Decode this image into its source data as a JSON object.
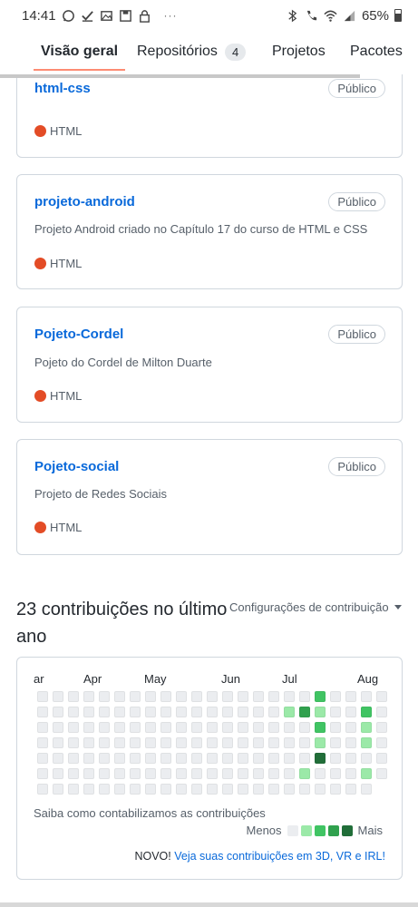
{
  "status_bar": {
    "time": "14:41",
    "battery": "65%",
    "left_icons": [
      "whatsapp-icon",
      "check-icon",
      "image-icon",
      "save-icon",
      "lock-icon"
    ],
    "right_icons": [
      "bluetooth-icon",
      "wifi-call-icon",
      "wifi-icon",
      "signal-icon",
      "battery-icon"
    ]
  },
  "tabs": [
    {
      "label": "Visão geral",
      "active": true
    },
    {
      "label": "Repositórios",
      "count": "4"
    },
    {
      "label": "Projetos"
    },
    {
      "label": "Pacotes"
    }
  ],
  "repos": [
    {
      "name": "html-css",
      "visibility": "Público",
      "description": "",
      "language": "HTML"
    },
    {
      "name": "projeto-android",
      "visibility": "Público",
      "description": "Projeto Android criado no Capítulo 17 do curso de HTML e CSS",
      "language": "HTML"
    },
    {
      "name": "Pojeto-Cordel",
      "visibility": "Público",
      "description": "Pojeto do Cordel de Milton Duarte",
      "language": "HTML"
    },
    {
      "name": "Pojeto-social",
      "visibility": "Público",
      "description": "Projeto de Redes Sociais",
      "language": "HTML"
    }
  ],
  "contributions": {
    "title": "23 contribuições no último ano",
    "settings_label": "Configurações de contribuição",
    "months": [
      "ar",
      "Apr",
      "May",
      "Jun",
      "Jul",
      "Aug"
    ],
    "learn_text": "Saiba como contabilizamos as contribuições",
    "legend_less": "Menos",
    "legend_more": "Mais",
    "new_prefix": "NOVO!",
    "new_link": "Veja suas contribuições em 3D, VR e IRL!",
    "levels_colors": [
      "#ebedf0",
      "#9be9a8",
      "#40c463",
      "#30a14e",
      "#216e39"
    ],
    "grid": [
      [
        0,
        0,
        0,
        0,
        0,
        0,
        0,
        0,
        0,
        0,
        0,
        0,
        0,
        0,
        0,
        0,
        0,
        0,
        2,
        0,
        0,
        0,
        0
      ],
      [
        0,
        0,
        0,
        0,
        0,
        0,
        0,
        0,
        0,
        0,
        0,
        0,
        0,
        0,
        0,
        0,
        1,
        3,
        1,
        0,
        0,
        2,
        0
      ],
      [
        0,
        0,
        0,
        0,
        0,
        0,
        0,
        0,
        0,
        0,
        0,
        0,
        0,
        0,
        0,
        0,
        0,
        0,
        2,
        0,
        0,
        1,
        0
      ],
      [
        0,
        0,
        0,
        0,
        0,
        0,
        0,
        0,
        0,
        0,
        0,
        0,
        0,
        0,
        0,
        0,
        0,
        0,
        1,
        0,
        0,
        1,
        0
      ],
      [
        0,
        0,
        0,
        0,
        0,
        0,
        0,
        0,
        0,
        0,
        0,
        0,
        0,
        0,
        0,
        0,
        0,
        0,
        4,
        0,
        0,
        0,
        0
      ],
      [
        0,
        0,
        0,
        0,
        0,
        0,
        0,
        0,
        0,
        0,
        0,
        0,
        0,
        0,
        0,
        0,
        0,
        1,
        0,
        0,
        0,
        1,
        0
      ],
      [
        0,
        0,
        0,
        0,
        0,
        0,
        0,
        0,
        0,
        0,
        0,
        0,
        0,
        0,
        0,
        0,
        0,
        0,
        0,
        0,
        0,
        0
      ]
    ]
  }
}
